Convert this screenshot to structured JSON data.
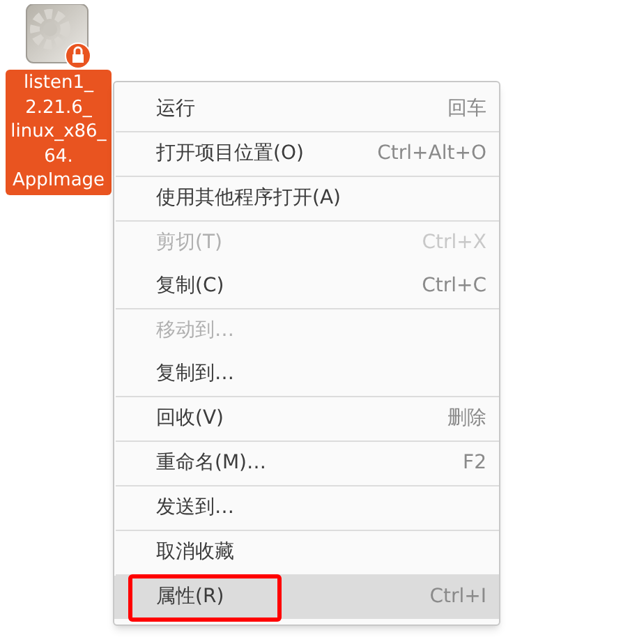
{
  "desktop_icon": {
    "label_lines": [
      "listen1_",
      "2.21.6_",
      "linux_x86_",
      "64.",
      "AppImage"
    ],
    "selected": true,
    "locked": true
  },
  "context_menu": {
    "groups": [
      [
        {
          "label": "运行",
          "shortcut": "回车",
          "disabled": false,
          "selected": false,
          "highlighted": false
        }
      ],
      [
        {
          "label": "打开项目位置(O)",
          "shortcut": "Ctrl+Alt+O",
          "disabled": false,
          "selected": false,
          "highlighted": false
        }
      ],
      [
        {
          "label": "使用其他程序打开(A)",
          "disabled": false,
          "selected": false,
          "highlighted": false
        }
      ],
      [
        {
          "label": "剪切(T)",
          "shortcut": "Ctrl+X",
          "disabled": true,
          "selected": false,
          "highlighted": false
        },
        {
          "label": "复制(C)",
          "shortcut": "Ctrl+C",
          "disabled": false,
          "selected": false,
          "highlighted": false
        }
      ],
      [
        {
          "label": "移动到…",
          "disabled": true,
          "selected": false,
          "highlighted": false
        },
        {
          "label": "复制到…",
          "disabled": false,
          "selected": false,
          "highlighted": false
        }
      ],
      [
        {
          "label": "回收(V)",
          "shortcut": "删除",
          "disabled": false,
          "selected": false,
          "highlighted": false
        }
      ],
      [
        {
          "label": "重命名(M)…",
          "shortcut": "F2",
          "disabled": false,
          "selected": false,
          "highlighted": false
        }
      ],
      [
        {
          "label": "发送到…",
          "disabled": false,
          "selected": false,
          "highlighted": false
        }
      ],
      [
        {
          "label": "取消收藏",
          "disabled": false,
          "selected": false,
          "highlighted": false
        }
      ],
      [
        {
          "label": "属性(R)",
          "shortcut": "Ctrl+I",
          "disabled": false,
          "selected": true,
          "highlighted": true
        }
      ]
    ]
  }
}
